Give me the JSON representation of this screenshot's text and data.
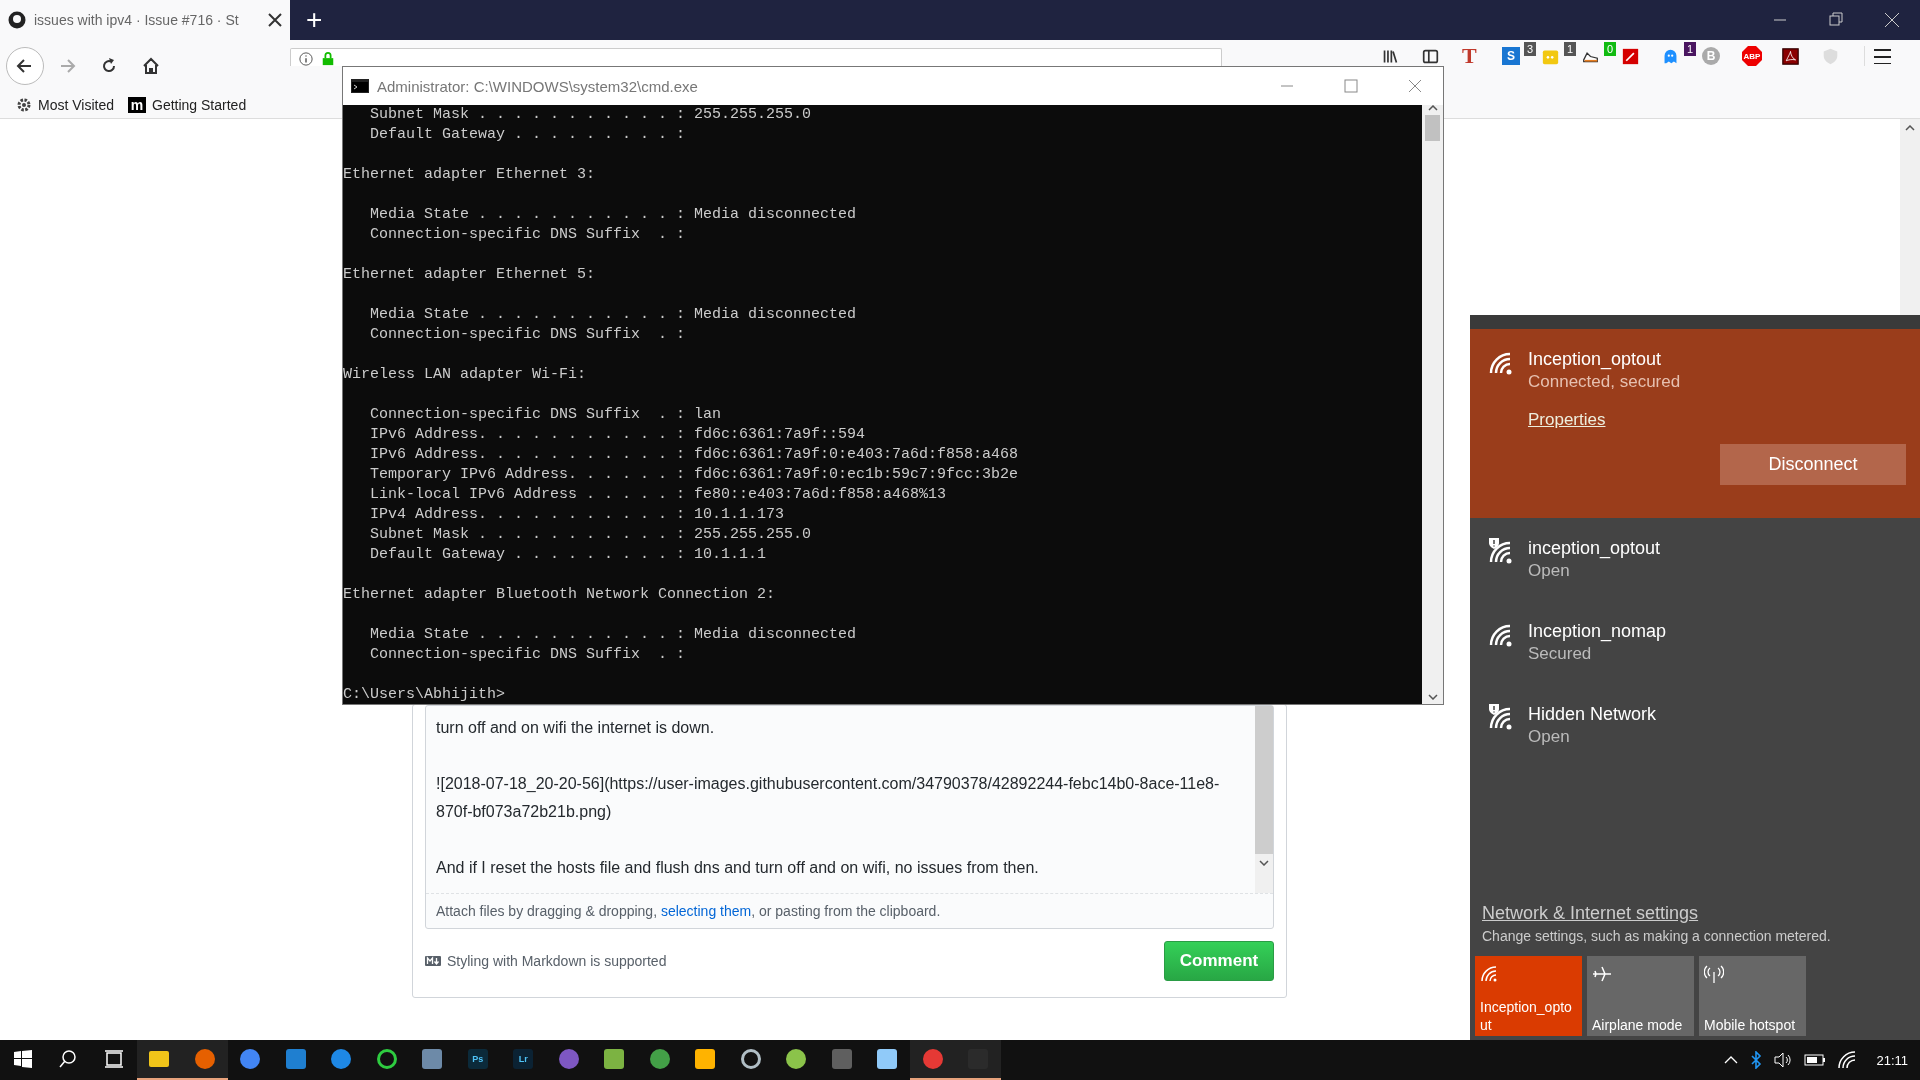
{
  "browser": {
    "tab": {
      "title": "issues with ipv4 · Issue #716 · St",
      "selected": true
    },
    "new_tab": "+",
    "toolbar": [
      {
        "kind": "library"
      },
      {
        "kind": "sidebar"
      },
      {
        "kind": "letter",
        "label": "T"
      },
      {
        "kind": "blue-square",
        "label": "S",
        "badge": "3"
      },
      {
        "kind": "yellow-dots",
        "badge": "1"
      },
      {
        "kind": "shoe",
        "badge": "0"
      },
      {
        "kind": "wand"
      },
      {
        "kind": "ghost",
        "badge": "1"
      },
      {
        "kind": "circle-letter",
        "label": "B"
      },
      {
        "kind": "octagon",
        "label": "ABP"
      },
      {
        "kind": "pdf"
      },
      {
        "kind": "shield"
      }
    ],
    "bookmarks": [
      {
        "kind": "gear",
        "label": "Most Visited"
      },
      {
        "kind": "logo",
        "logo": "m",
        "label": "Getting Started"
      }
    ]
  },
  "comment": {
    "paragraphs": [
      "turn off and on wifi the internet is down.",
      "![2018-07-18_20-20-56](https://user-images.githubusercontent.com/34790378/42892244-febc14b0-8ace-11e8-870f-bf073a72b21b.png)",
      "And if I reset the hosts file and flush dns and turn off and on wifi, no issues from then."
    ],
    "attach": {
      "before": "Attach files by dragging & dropping, ",
      "link": "selecting them",
      "after": ", or pasting from the clipboard."
    },
    "markdown_note": "Styling with Markdown is supported",
    "submit": "Comment"
  },
  "cmd": {
    "title": "Administrator: C:\\WINDOWS\\system32\\cmd.exe",
    "blocks": [
      [
        "   Subnet Mask . . . . . . . . . . . : 255.255.255.0",
        "   Default Gateway . . . . . . . . . :"
      ],
      [
        "Ethernet adapter Ethernet 3:"
      ],
      [
        "   Media State . . . . . . . . . . . : Media disconnected",
        "   Connection-specific DNS Suffix  . :"
      ],
      [
        "Ethernet adapter Ethernet 5:"
      ],
      [
        "   Media State . . . . . . . . . . . : Media disconnected",
        "   Connection-specific DNS Suffix  . :"
      ],
      [
        "Wireless LAN adapter Wi-Fi:"
      ],
      [
        "   Connection-specific DNS Suffix  . : lan",
        "   IPv6 Address. . . . . . . . . . . : fd6c:6361:7a9f::594",
        "   IPv6 Address. . . . . . . . . . . : fd6c:6361:7a9f:0:e403:7a6d:f858:a468",
        "   Temporary IPv6 Address. . . . . . : fd6c:6361:7a9f:0:ec1b:59c7:9fcc:3b2e",
        "   Link-local IPv6 Address . . . . . : fe80::e403:7a6d:f858:a468%13",
        "   IPv4 Address. . . . . . . . . . . : 10.1.1.173",
        "   Subnet Mask . . . . . . . . . . . : 255.255.255.0",
        "   Default Gateway . . . . . . . . . : 10.1.1.1"
      ],
      [
        "Ethernet adapter Bluetooth Network Connection 2:"
      ],
      [
        "   Media State . . . . . . . . . . . : Media disconnected",
        "   Connection-specific DNS Suffix  . :"
      ],
      [
        "C:\\Users\\Abhijith>"
      ]
    ]
  },
  "network_flyout": {
    "properties": "Properties",
    "disconnect": "Disconnect",
    "networks": [
      {
        "name": "Inception_optout",
        "status": "Connected, secured",
        "selected": true,
        "secure": true
      },
      {
        "name": "inception_optout",
        "status": "Open",
        "selected": false,
        "secure": false
      },
      {
        "name": "Inception_nomap",
        "status": "Secured",
        "selected": false,
        "secure": true
      },
      {
        "name": "Hidden Network",
        "status": "Open",
        "selected": false,
        "secure": false
      }
    ],
    "settings_link": "Network & Internet settings",
    "settings_hint": "Change settings, such as making a connection metered.",
    "quick_actions": [
      {
        "kind": "wifi",
        "label": "Inception_optout",
        "on": true
      },
      {
        "kind": "airplane",
        "label": "Airplane mode",
        "on": false
      },
      {
        "kind": "hotspot",
        "label": "Mobile hotspot",
        "on": false
      }
    ]
  },
  "taskbar": {
    "apps": [
      {
        "kind": "folder",
        "color": "#f0c419",
        "open": true
      },
      {
        "kind": "circle",
        "color": "#e66000",
        "open": true
      },
      {
        "kind": "circle",
        "color": "#4285f4",
        "open": false
      },
      {
        "kind": "square",
        "color": "#1f7fd0",
        "open": false
      },
      {
        "kind": "circle",
        "color": "#1e88e5",
        "open": false
      },
      {
        "kind": "ring",
        "color": "#2ecc40",
        "open": false
      },
      {
        "kind": "square",
        "color": "#6d8aa8",
        "open": false
      },
      {
        "kind": "square",
        "color": "#0b2a3a",
        "label": "Ps",
        "open": false
      },
      {
        "kind": "square",
        "color": "#0b2233",
        "label": "Lr",
        "open": false
      },
      {
        "kind": "circle",
        "color": "#7e57c2",
        "open": false
      },
      {
        "kind": "square",
        "color": "#7cb342",
        "open": false
      },
      {
        "kind": "circle",
        "color": "#43a047",
        "open": false
      },
      {
        "kind": "square",
        "color": "#ffb300",
        "open": false
      },
      {
        "kind": "ring",
        "color": "#b0bec5",
        "open": false
      },
      {
        "kind": "circle",
        "color": "#8bc34a",
        "open": false
      },
      {
        "kind": "square",
        "color": "#5f5f5f",
        "open": false
      },
      {
        "kind": "square",
        "color": "#90caf9",
        "open": false
      },
      {
        "kind": "circle",
        "color": "#e53935",
        "open": true
      },
      {
        "kind": "square",
        "color": "#2b2b2b",
        "open": true
      }
    ],
    "clock": "21:11"
  }
}
